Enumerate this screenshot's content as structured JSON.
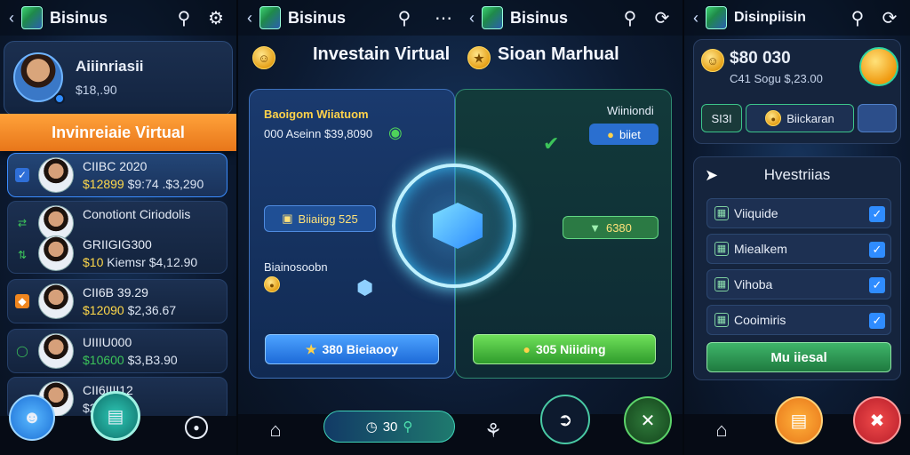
{
  "screen1": {
    "title": "Bisinus",
    "profile": {
      "name": "Aiiinriasii",
      "balance": "$18,.90"
    },
    "banner": "Invinreiaie Virtual",
    "rows": [
      {
        "title": "CIIBC 2020",
        "sub_green": "$12899",
        "sub_rest": "$9:74 .$3,290"
      },
      {
        "title": "Conotiont Ciriodolis",
        "sub_green": "",
        "sub_rest": ""
      },
      {
        "title": "GRIIGIG300",
        "sub_green": "$10",
        "sub_rest": "Kiemsr $4,12.90"
      },
      {
        "title": "CII6B 39.29",
        "sub_green": "$12090",
        "sub_rest": "$2,36.67"
      },
      {
        "title": "UIIIU000",
        "sub_green": "$10600",
        "sub_rest": "$3,B3.90"
      },
      {
        "title": "CII6IIII12",
        "sub_green": "",
        "sub_rest": "$2 37"
      }
    ]
  },
  "screen2": {
    "title": "Bisinus",
    "header_left": "Investain Virtual",
    "header_right": "Sioan Marhual",
    "left_card": {
      "heading": "Baoigom Wiiatuom",
      "line": "000 Aseinn $39,8090",
      "pill": "Biiaiigg 525",
      "label": "Biainosoobn",
      "button": "380 Bieiaooy"
    },
    "right_card": {
      "heading": "Wiiniondi",
      "pill_top": "biiet",
      "pill_mid": "6380",
      "button": "305 Niiiding"
    },
    "nav_pill": "30"
  },
  "screen4": {
    "title": "Disinpiisin",
    "balance": "$80 030",
    "sub": "C41 Sogu $,23.00",
    "tab_left": "SI3I",
    "tab_mid": "Biickaran",
    "section_title": "Hvestriias",
    "options": [
      "Viiquide",
      "Miealkem",
      "Vihoba",
      "Cooimiris"
    ],
    "button": "Mu iiesal"
  },
  "colors": {
    "accent_orange": "#f0861f",
    "accent_green": "#3cc45a",
    "accent_blue": "#2f8cff"
  }
}
